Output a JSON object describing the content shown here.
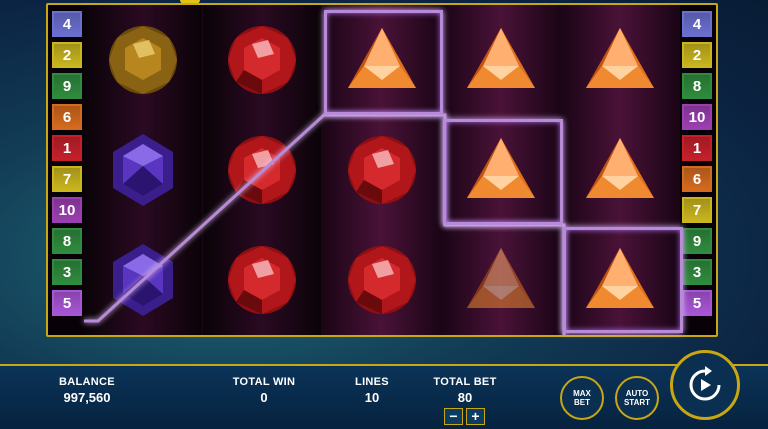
{
  "lines_left": [
    {
      "num": "4",
      "color": "#6a6fd0"
    },
    {
      "num": "2",
      "color": "#c9b51e"
    },
    {
      "num": "9",
      "color": "#2f8b3d"
    },
    {
      "num": "6",
      "color": "#d46a1e"
    },
    {
      "num": "1",
      "color": "#c4202a"
    },
    {
      "num": "7",
      "color": "#c9b51e"
    },
    {
      "num": "10",
      "color": "#9a3fb0"
    },
    {
      "num": "8",
      "color": "#2f8b3d"
    },
    {
      "num": "3",
      "color": "#2f8b3d"
    },
    {
      "num": "5",
      "color": "#a855d6"
    }
  ],
  "lines_right": [
    {
      "num": "4",
      "color": "#6a6fd0"
    },
    {
      "num": "2",
      "color": "#c9b51e"
    },
    {
      "num": "8",
      "color": "#2f8b3d"
    },
    {
      "num": "10",
      "color": "#9a3fb0"
    },
    {
      "num": "1",
      "color": "#c4202a"
    },
    {
      "num": "6",
      "color": "#d46a1e"
    },
    {
      "num": "7",
      "color": "#c9b51e"
    },
    {
      "num": "9",
      "color": "#2f8b3d"
    },
    {
      "num": "3",
      "color": "#2f8b3d"
    },
    {
      "num": "5",
      "color": "#a855d6"
    }
  ],
  "reels": [
    [
      "yellow-gem",
      "purple-gem",
      "purple-gem"
    ],
    [
      "red-gem",
      "red-gem",
      "red-gem"
    ],
    [
      "orange-triangle",
      "red-gem",
      "red-gem"
    ],
    [
      "orange-triangle",
      "orange-triangle",
      "orange-triangle"
    ],
    [
      "orange-triangle",
      "orange-triangle",
      "orange-triangle"
    ]
  ],
  "bar": {
    "balance_label": "BALANCE",
    "balance_value": "997,560",
    "total_win_label": "TOTAL WIN",
    "total_win_value": "0",
    "lines_label": "LINES",
    "lines_value": "10",
    "total_bet_label": "TOTAL BET",
    "total_bet_value": "80",
    "minus": "−",
    "plus": "+",
    "max_bet": "MAX\nBET",
    "auto_start": "AUTO\nSTART"
  },
  "colors": {
    "frame_gold": "#c9a714",
    "payline": "#b98ad8"
  }
}
